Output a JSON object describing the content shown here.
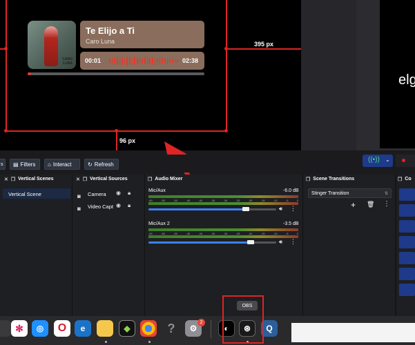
{
  "preview": {
    "song_title": "Te Elijo a Ti",
    "artist": "Caro Luna",
    "time_current": "00:01",
    "time_total": "02:38",
    "progress": 0.02,
    "album_caption": "CARO\nLUNA",
    "dim_right": "395 px",
    "dim_bottom": "96 px",
    "right_scene_text": "elg"
  },
  "toolbar": {
    "filters_label": "Filters",
    "interact_label": "Interact",
    "refresh_label": "Refresh"
  },
  "scenes": {
    "title": "Vertical Scenes",
    "items": [
      "Vertical Scene"
    ]
  },
  "sources": {
    "title": "Vertical Sources",
    "items": [
      "Camera",
      "Video Capt"
    ]
  },
  "mixer": {
    "title": "Audio Mixer",
    "channels": [
      {
        "name": "Mic/Aux",
        "db": "-6.0 dB",
        "level": 0.76
      },
      {
        "name": "Mic/Aux 2",
        "db": "-3.5 dB",
        "level": 0.8
      }
    ],
    "scale": [
      "-60",
      "-55",
      "-50",
      "-45",
      "-40",
      "-35",
      "-30",
      "-25",
      "-20",
      "-15",
      "-10",
      "-5",
      "0"
    ]
  },
  "transitions": {
    "title": "Scene Transitions",
    "selected": "Stinger Transition"
  },
  "controls": {
    "title": "Co"
  },
  "dock": {
    "tooltip": "OBS",
    "badge": "2"
  },
  "colors": {
    "accent_red": "#e02424",
    "card_bg": "#8a6d5c",
    "fader_blue": "#3b82f6"
  }
}
